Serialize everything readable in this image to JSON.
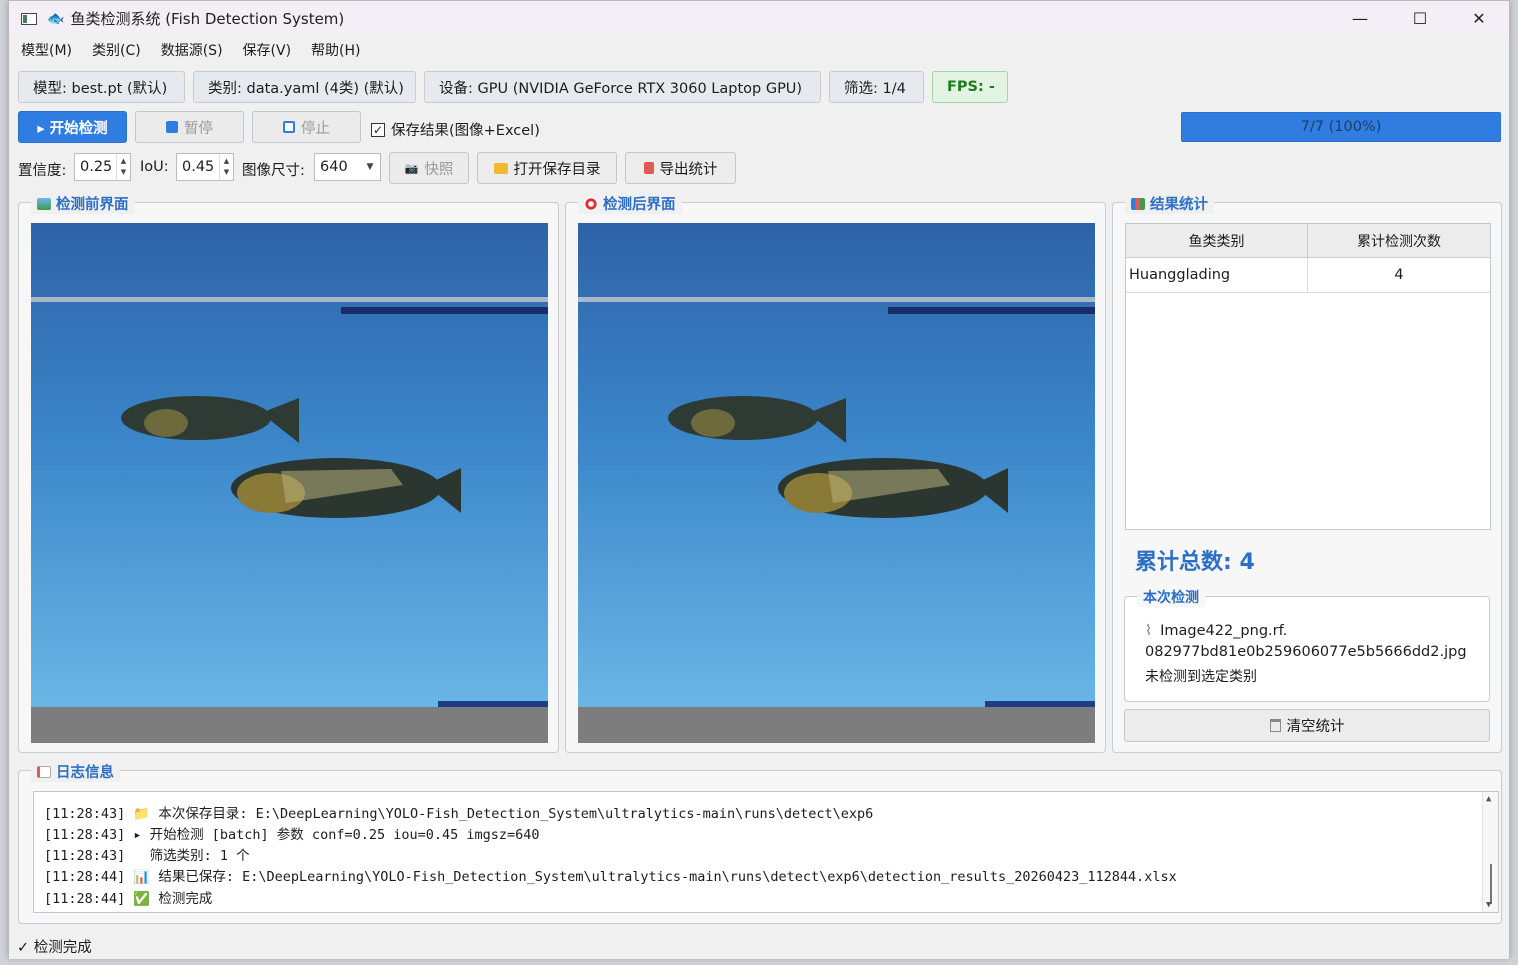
{
  "window": {
    "title": "鱼类检测系统 (Fish Detection System)",
    "fish_glyph": "🐟",
    "minimize": "—",
    "maximize": "☐",
    "close": "✕"
  },
  "menu": [
    "模型(M)",
    "类别(C)",
    "数据源(S)",
    "保存(V)",
    "帮助(H)"
  ],
  "info": {
    "model": "模型: best.pt (默认)",
    "classes": "类别: data.yaml (4类) (默认)",
    "device": "设备: GPU (NVIDIA GeForce RTX 3060 Laptop GPU)",
    "filter": "筛选: 1/4",
    "fps": "FPS: -"
  },
  "controls": {
    "start": "▸ 开始检测",
    "pause": "暂停",
    "stop": "停止",
    "save_results": "保存结果(图像+Excel)",
    "save_checked": "✓",
    "progress": "7/7 (100%)",
    "progress_value": 1.0
  },
  "params": {
    "conf_label": "置信度:",
    "conf_value": "0.25",
    "iou_label": "IoU:",
    "iou_value": "0.45",
    "imgsz_label": "图像尺寸:",
    "imgsz_value": "640",
    "snapshot": "快照",
    "open_dir": "打开保存目录",
    "export": "导出统计"
  },
  "panels": {
    "before_title": "检测前界面",
    "after_title": "检测后界面",
    "stats_title": "结果统计",
    "log_title": "日志信息"
  },
  "stats": {
    "headers": [
      "鱼类类别",
      "累计检测次数"
    ],
    "rows": [
      {
        "class": "Huangglading",
        "count": "4"
      }
    ],
    "total": "累计总数: 4",
    "current_title": "本次检测",
    "current_file": "Image422_png.rf.",
    "current_file2": "082977bd81e0b259606077e5b5666dd2.jpg",
    "current_result": "未检测到选定类别",
    "clear": "清空统计"
  },
  "log": [
    "[11:28:43] 📁 本次保存目录: E:\\DeepLearning\\YOLO-Fish_Detection_System\\ultralytics-main\\runs\\detect\\exp6",
    "[11:28:43] ▸ 开始检测 [batch] 参数 conf=0.25 iou=0.45 imgsz=640",
    "[11:28:43]   筛选类别: 1 个",
    "[11:28:44] 📊 结果已保存: E:\\DeepLearning\\YOLO-Fish_Detection_System\\ultralytics-main\\runs\\detect\\exp6\\detection_results_20260423_112844.xlsx",
    "[11:28:44] ✅ 检测完成"
  ],
  "status": "✓ 检测完成",
  "colors": {
    "accent": "#2f7de1",
    "group_title": "#2d6fc7",
    "fps_green": "#1b7e1b"
  }
}
